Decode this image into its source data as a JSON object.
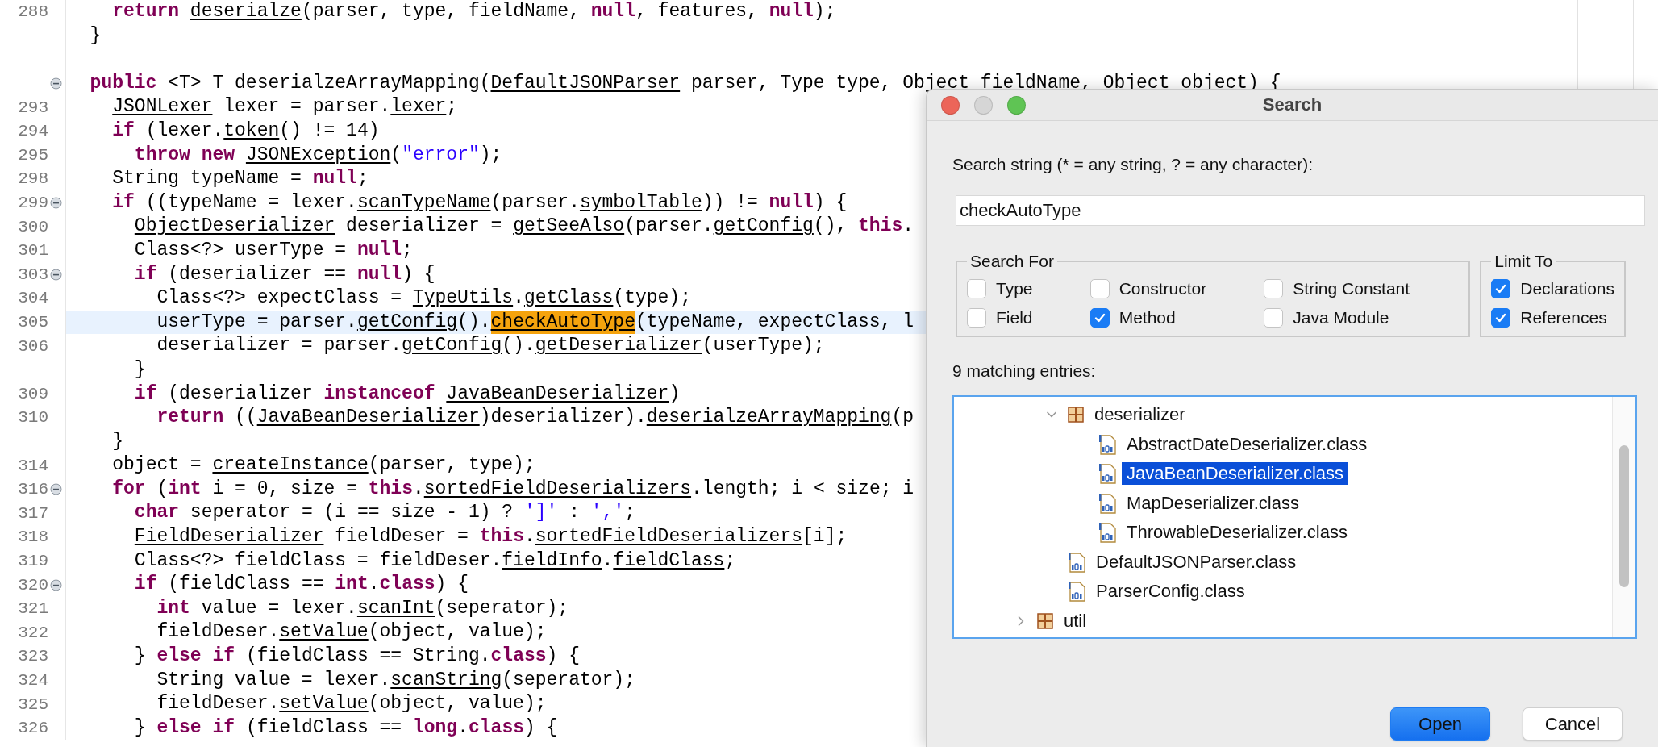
{
  "editor": {
    "lines": [
      {
        "number": "288",
        "folding": false,
        "current": false,
        "tokens": [
          {
            "kind": "kw",
            "text": "    return"
          },
          {
            "kind": "ref",
            "text": " deserialze"
          },
          {
            "kind": "plain",
            "text": "(parser, type, fieldName, "
          },
          {
            "kind": "kw",
            "text": "null"
          },
          {
            "kind": "plain",
            "text": ", features, "
          },
          {
            "kind": "kw",
            "text": "null"
          },
          {
            "kind": "plain",
            "text": ");"
          }
        ]
      },
      {
        "folding": false,
        "current": false,
        "tokens": [
          {
            "kind": "plain",
            "text": "  }"
          }
        ]
      },
      {
        "folding": false,
        "current": false
      },
      {
        "folding": true,
        "current": false,
        "tokens": [
          {
            "kind": "kw",
            "text": "  public"
          },
          {
            "kind": "plain",
            "text": " <T> T deserialzeArrayMapping("
          },
          {
            "kind": "ref",
            "text": "DefaultJSONParser"
          },
          {
            "kind": "plain",
            "text": " parser, Type type, Object fieldName, Object object) {"
          }
        ]
      },
      {
        "number": "293",
        "folding": false,
        "current": false,
        "tokens": [
          {
            "kind": "ref",
            "text": "    JSONLexer"
          },
          {
            "kind": "plain",
            "text": " lexer = parser."
          },
          {
            "kind": "ref",
            "text": "lexer"
          },
          {
            "kind": "plain",
            "text": ";"
          }
        ]
      },
      {
        "number": "294",
        "folding": false,
        "current": false,
        "tokens": [
          {
            "kind": "kw",
            "text": "    if"
          },
          {
            "kind": "plain",
            "text": " (lexer."
          },
          {
            "kind": "ref",
            "text": "token"
          },
          {
            "kind": "plain",
            "text": "() != 14)"
          }
        ]
      },
      {
        "number": "295",
        "folding": false,
        "current": false,
        "tokens": [
          {
            "kind": "kw",
            "text": "      throw"
          },
          {
            "kind": "kw",
            "text": " new"
          },
          {
            "kind": "ref",
            "text": " JSONException"
          },
          {
            "kind": "plain",
            "text": "("
          },
          {
            "kind": "str",
            "text": "\"error\""
          },
          {
            "kind": "plain",
            "text": ");"
          }
        ]
      },
      {
        "number": "298",
        "folding": false,
        "current": false,
        "tokens": [
          {
            "kind": "plain",
            "text": "    String typeName = "
          },
          {
            "kind": "kw",
            "text": "null"
          },
          {
            "kind": "plain",
            "text": ";"
          }
        ]
      },
      {
        "number": "299",
        "folding": true,
        "current": false,
        "tokens": [
          {
            "kind": "kw",
            "text": "    if"
          },
          {
            "kind": "plain",
            "text": " ((typeName = lexer."
          },
          {
            "kind": "ref",
            "text": "scanTypeName"
          },
          {
            "kind": "plain",
            "text": "(parser."
          },
          {
            "kind": "ref",
            "text": "symbolTable"
          },
          {
            "kind": "plain",
            "text": ")) != "
          },
          {
            "kind": "kw",
            "text": "null"
          },
          {
            "kind": "plain",
            "text": ") {"
          }
        ]
      },
      {
        "number": "300",
        "folding": false,
        "current": false,
        "tokens": [
          {
            "kind": "ref",
            "text": "      ObjectDeserializer"
          },
          {
            "kind": "plain",
            "text": " deserializer = "
          },
          {
            "kind": "ref",
            "text": "getSeeAlso"
          },
          {
            "kind": "plain",
            "text": "(parser."
          },
          {
            "kind": "ref",
            "text": "getConfig"
          },
          {
            "kind": "plain",
            "text": "(), "
          },
          {
            "kind": "kw",
            "text": "this"
          },
          {
            "kind": "plain",
            "text": "."
          }
        ]
      },
      {
        "number": "301",
        "folding": false,
        "current": false,
        "tokens": [
          {
            "kind": "plain",
            "text": "      Class<?> userType = "
          },
          {
            "kind": "kw",
            "text": "null"
          },
          {
            "kind": "plain",
            "text": ";"
          }
        ]
      },
      {
        "number": "303",
        "folding": true,
        "current": false,
        "tokens": [
          {
            "kind": "kw",
            "text": "      if"
          },
          {
            "kind": "plain",
            "text": " (deserializer == "
          },
          {
            "kind": "kw",
            "text": "null"
          },
          {
            "kind": "plain",
            "text": ") {"
          }
        ]
      },
      {
        "number": "304",
        "folding": false,
        "current": false,
        "tokens": [
          {
            "kind": "plain",
            "text": "        Class<?> expectClass = "
          },
          {
            "kind": "ref",
            "text": "TypeUtils"
          },
          {
            "kind": "ref",
            "text": ".getClass"
          },
          {
            "kind": "plain",
            "text": "(type);"
          }
        ]
      },
      {
        "number": "305",
        "folding": false,
        "current": true,
        "tokens": [
          {
            "kind": "plain",
            "text": "        userType = parser."
          },
          {
            "kind": "ref",
            "text": "getConfig"
          },
          {
            "kind": "plain",
            "text": "()."
          },
          {
            "kind": "match",
            "text": "checkAutoType"
          },
          {
            "kind": "plain",
            "text": "(typeName, expectClass, l"
          }
        ]
      },
      {
        "number": "306",
        "folding": false,
        "current": false,
        "tokens": [
          {
            "kind": "plain",
            "text": "        deserializer = parser."
          },
          {
            "kind": "ref",
            "text": "getConfig"
          },
          {
            "kind": "plain",
            "text": "()."
          },
          {
            "kind": "ref",
            "text": "getDeserializer"
          },
          {
            "kind": "plain",
            "text": "(userType);"
          }
        ]
      },
      {
        "folding": false,
        "current": false,
        "tokens": [
          {
            "kind": "plain",
            "text": "      }"
          }
        ]
      },
      {
        "number": "309",
        "folding": false,
        "current": false,
        "tokens": [
          {
            "kind": "kw",
            "text": "      if"
          },
          {
            "kind": "plain",
            "text": " (deserializer "
          },
          {
            "kind": "kw",
            "text": "instanceof"
          },
          {
            "kind": "ref",
            "text": " JavaBeanDeserializer"
          },
          {
            "kind": "plain",
            "text": ")"
          }
        ]
      },
      {
        "number": "310",
        "folding": false,
        "current": false,
        "tokens": [
          {
            "kind": "kw",
            "text": "        return"
          },
          {
            "kind": "plain",
            "text": " (("
          },
          {
            "kind": "ref",
            "text": "JavaBeanDeserializer"
          },
          {
            "kind": "plain",
            "text": ")deserializer)."
          },
          {
            "kind": "ref",
            "text": "deserialzeArrayMapping"
          },
          {
            "kind": "plain",
            "text": "(p"
          }
        ]
      },
      {
        "folding": false,
        "current": false,
        "tokens": [
          {
            "kind": "plain",
            "text": "    }"
          }
        ]
      },
      {
        "number": "314",
        "folding": false,
        "current": false,
        "tokens": [
          {
            "kind": "plain",
            "text": "    object = "
          },
          {
            "kind": "ref",
            "text": "createInstance"
          },
          {
            "kind": "plain",
            "text": "(parser, type);"
          }
        ]
      },
      {
        "number": "316",
        "folding": true,
        "current": false,
        "tokens": [
          {
            "kind": "kw",
            "text": "    for"
          },
          {
            "kind": "plain",
            "text": " ("
          },
          {
            "kind": "kw",
            "text": "int"
          },
          {
            "kind": "plain",
            "text": " i = 0, size = "
          },
          {
            "kind": "kw",
            "text": "this"
          },
          {
            "kind": "ref",
            "text": ".sortedFieldDeserializers"
          },
          {
            "kind": "plain",
            "text": ".length; i < size; i"
          }
        ]
      },
      {
        "number": "317",
        "folding": false,
        "current": false,
        "tokens": [
          {
            "kind": "kw",
            "text": "      char"
          },
          {
            "kind": "plain",
            "text": " seperator = (i == size - 1) ? "
          },
          {
            "kind": "str",
            "text": "']'"
          },
          {
            "kind": "plain",
            "text": " : "
          },
          {
            "kind": "str",
            "text": "','"
          },
          {
            "kind": "plain",
            "text": ";"
          }
        ]
      },
      {
        "number": "318",
        "folding": false,
        "current": false,
        "tokens": [
          {
            "kind": "ref",
            "text": "      FieldDeserializer"
          },
          {
            "kind": "plain",
            "text": " fieldDeser = "
          },
          {
            "kind": "kw",
            "text": "this"
          },
          {
            "kind": "ref",
            "text": ".sortedFieldDeserializers"
          },
          {
            "kind": "plain",
            "text": "[i];"
          }
        ]
      },
      {
        "number": "319",
        "folding": false,
        "current": false,
        "tokens": [
          {
            "kind": "plain",
            "text": "      Class<?> fieldClass = fieldDeser."
          },
          {
            "kind": "ref",
            "text": "fieldInfo"
          },
          {
            "kind": "ref",
            "text": ".fieldClass"
          },
          {
            "kind": "plain",
            "text": ";"
          }
        ]
      },
      {
        "number": "320",
        "folding": true,
        "current": false,
        "tokens": [
          {
            "kind": "kw",
            "text": "      if"
          },
          {
            "kind": "plain",
            "text": " (fieldClass == "
          },
          {
            "kind": "kw",
            "text": "int"
          },
          {
            "kind": "kw",
            "text": ".class"
          },
          {
            "kind": "plain",
            "text": ") {"
          }
        ]
      },
      {
        "number": "321",
        "folding": false,
        "current": false,
        "tokens": [
          {
            "kind": "kw",
            "text": "        int"
          },
          {
            "kind": "plain",
            "text": " value = lexer."
          },
          {
            "kind": "ref",
            "text": "scanInt"
          },
          {
            "kind": "plain",
            "text": "(seperator);"
          }
        ]
      },
      {
        "number": "322",
        "folding": false,
        "current": false,
        "tokens": [
          {
            "kind": "plain",
            "text": "        fieldDeser."
          },
          {
            "kind": "ref",
            "text": "setValue"
          },
          {
            "kind": "plain",
            "text": "(object, value);"
          }
        ]
      },
      {
        "number": "323",
        "folding": false,
        "current": false,
        "tokens": [
          {
            "kind": "plain",
            "text": "      } "
          },
          {
            "kind": "kw",
            "text": "else"
          },
          {
            "kind": "kw",
            "text": " if"
          },
          {
            "kind": "plain",
            "text": " (fieldClass == String."
          },
          {
            "kind": "kw",
            "text": "class"
          },
          {
            "kind": "plain",
            "text": ") {"
          }
        ]
      },
      {
        "number": "324",
        "folding": false,
        "current": false,
        "tokens": [
          {
            "kind": "plain",
            "text": "        String value = lexer."
          },
          {
            "kind": "ref",
            "text": "scanString"
          },
          {
            "kind": "plain",
            "text": "(seperator);"
          }
        ]
      },
      {
        "number": "325",
        "folding": false,
        "current": false,
        "tokens": [
          {
            "kind": "plain",
            "text": "        fieldDeser."
          },
          {
            "kind": "ref",
            "text": "setValue"
          },
          {
            "kind": "plain",
            "text": "(object, value);"
          }
        ]
      },
      {
        "number": "326",
        "folding": false,
        "current": false,
        "tokens": [
          {
            "kind": "plain",
            "text": "      } "
          },
          {
            "kind": "kw",
            "text": "else"
          },
          {
            "kind": "kw",
            "text": " if"
          },
          {
            "kind": "plain",
            "text": " (fieldClass == "
          },
          {
            "kind": "kw",
            "text": "long"
          },
          {
            "kind": "kw",
            "text": ".class"
          },
          {
            "kind": "plain",
            "text": ") {"
          }
        ]
      }
    ]
  },
  "dialog": {
    "title": "Search",
    "prompt": "Search string (* = any string, ? = any character):",
    "search_value": "checkAutoType",
    "search_for": {
      "title": "Search For",
      "options": [
        {
          "label": "Type",
          "checked": false
        },
        {
          "label": "Constructor",
          "checked": false
        },
        {
          "label": "String Constant",
          "checked": false
        },
        {
          "label": "Field",
          "checked": false
        },
        {
          "label": "Method",
          "checked": true
        },
        {
          "label": "Java Module",
          "checked": false
        }
      ]
    },
    "limit_to": {
      "title": "Limit To",
      "options": [
        {
          "label": "Declarations",
          "checked": true
        },
        {
          "label": "References",
          "checked": true
        }
      ]
    },
    "result_count": "9 matching entries:",
    "tree": {
      "items": [
        {
          "children": [
            {
              "kind": "package",
              "label": "deserializer",
              "expanded": true,
              "selected": false,
              "children": [
                {
                  "kind": "class",
                  "label": "AbstractDateDeserializer.class",
                  "selected": false
                },
                {
                  "kind": "class",
                  "label": "JavaBeanDeserializer.class",
                  "selected": true
                },
                {
                  "kind": "class",
                  "label": "MapDeserializer.class",
                  "selected": false
                },
                {
                  "kind": "class",
                  "label": "ThrowableDeserializer.class",
                  "selected": false
                }
              ]
            },
            {
              "kind": "class",
              "label": "DefaultJSONParser.class",
              "selected": false
            },
            {
              "kind": "class",
              "label": "ParserConfig.class",
              "selected": false
            }
          ]
        },
        {
          "kind": "package",
          "label": "util",
          "expanded": false,
          "selected": false
        }
      ]
    },
    "buttons": [
      {
        "label": "Open",
        "default": true
      },
      {
        "label": "Cancel",
        "default": false
      }
    ]
  }
}
